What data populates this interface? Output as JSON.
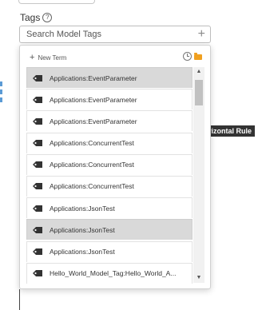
{
  "field": {
    "label": "Tags",
    "help_glyph": "?",
    "search_placeholder": "Search Model Tags",
    "add_glyph": "+"
  },
  "dropdown": {
    "new_term_glyph": "+",
    "new_term_label": "New Term",
    "items": [
      {
        "label": "Applications:EventParameter",
        "selected": true
      },
      {
        "label": "Applications:EventParameter",
        "selected": false
      },
      {
        "label": "Applications:EventParameter",
        "selected": false
      },
      {
        "label": "Applications:ConcurrentTest",
        "selected": false
      },
      {
        "label": "Applications:ConcurrentTest",
        "selected": false
      },
      {
        "label": "Applications:ConcurrentTest",
        "selected": false
      },
      {
        "label": "Applications:JsonTest",
        "selected": false
      },
      {
        "label": "Applications:JsonTest",
        "selected": true
      },
      {
        "label": "Applications:JsonTest",
        "selected": false
      },
      {
        "label": "Hello_World_Model_Tag:Hello_World_A...",
        "selected": false
      }
    ],
    "scroll_up_glyph": "▲",
    "scroll_down_glyph": "▼"
  },
  "background": {
    "right_label": "rizontal Rule"
  },
  "colors": {
    "selected_row": "#d9d9d9",
    "folder_icon": "#f0a020",
    "tag_icon": "#333333"
  }
}
